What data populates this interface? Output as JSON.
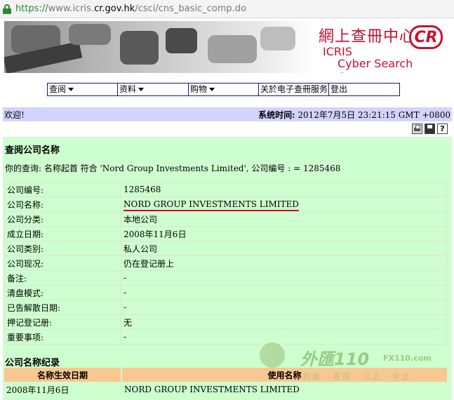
{
  "browser": {
    "url_scheme": "https://",
    "url_prefix": "www.icris.",
    "url_domain": "cr.gov.hk",
    "url_path": "/csci/cns_basic_comp.do"
  },
  "banner": {
    "title_zh": "網上查冊中心",
    "logo": "CR",
    "brand": "ICRIS",
    "subtitle": "Cyber Search Centre",
    "brand_color": "#c8102e"
  },
  "menu": {
    "items": [
      {
        "label": "查阅",
        "has_dropdown": true
      },
      {
        "label": "资料",
        "has_dropdown": true
      },
      {
        "label": "购物",
        "has_dropdown": true
      },
      {
        "label": "关於电子查冊服务",
        "has_dropdown": false
      },
      {
        "label": "登出",
        "has_dropdown": false
      }
    ]
  },
  "welcome": {
    "greeting": "欢迎!",
    "sys_time_label": "系统时间:",
    "sys_time_value": "2012年7月5日 23:21:15 GMT +0800"
  },
  "tools": [
    "printer-icon",
    "save-icon",
    "help-icon"
  ],
  "main": {
    "section_title": "查阅公司名称",
    "query_text": "你的查询: 名称起首 符合 'Nord Group Investments Limited', 公司编号 : = 1285468",
    "details": [
      {
        "label": "公司编号:",
        "value": "1285468"
      },
      {
        "label": "公司名称:",
        "value": "NORD GROUP INVESTMENTS LIMITED"
      },
      {
        "label": "公司分类:",
        "value": "本地公司"
      },
      {
        "label": "成立日期:",
        "value": "2008年11月6日"
      },
      {
        "label": "公司类别:",
        "value": "私人公司"
      },
      {
        "label": "公司现况:",
        "value": "仍在登记册上"
      },
      {
        "label": "备注:",
        "value": "-"
      },
      {
        "label": "清盘模式:",
        "value": "-"
      },
      {
        "label": "已告解散日期:",
        "value": "-"
      },
      {
        "label": "押记登记册:",
        "value": "无"
      },
      {
        "label": "重要事项:",
        "value": "-"
      }
    ],
    "history_title": "公司名称纪录",
    "history_headers": [
      "名称生效日期",
      "使用名称"
    ],
    "history_rows": [
      [
        "2008年11月6日",
        "NORD GROUP INVESTMENTS LIMITED"
      ]
    ],
    "panel_color": "#ceffce",
    "header_color": "#f8c890"
  },
  "watermark": {
    "brand": "外匯110",
    "site": "FX110.com",
    "slogan": "权威 · 客观 · 公正 · 中立"
  }
}
